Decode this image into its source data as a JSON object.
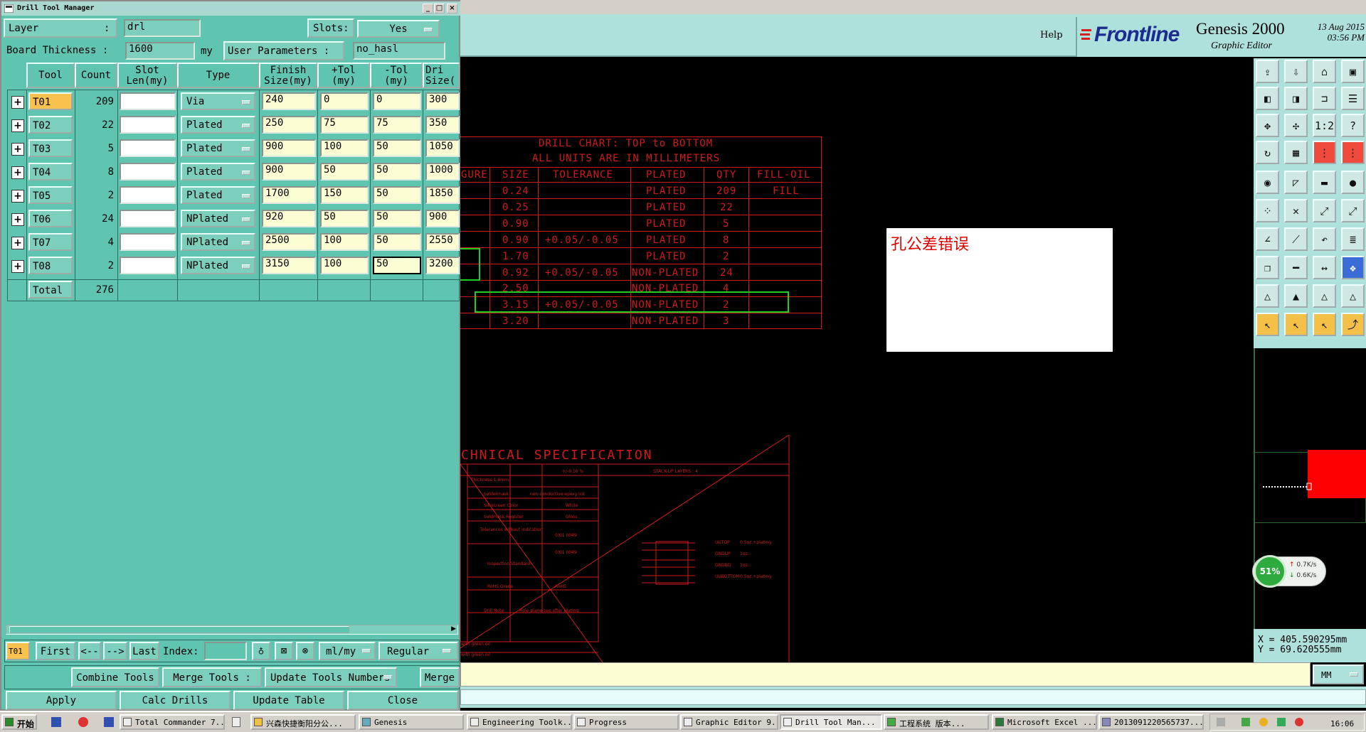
{
  "dialog": {
    "title": "Drill Tool Manager",
    "layer_label": "Layer",
    "layer_value": "drl",
    "slots_label": "Slots:",
    "slots_value": "Yes",
    "board_thickness_label": "Board Thickness :",
    "board_thickness_value": "1600",
    "board_thickness_unit": "my",
    "user_params_label": "User Parameters :",
    "user_params_value": "no_hasl",
    "columns": [
      "Tool",
      "Count",
      "Slot Len(my)",
      "Type",
      "Finish Size(my)",
      "+Tol (my)",
      "-Tol (my)",
      "Dri Size("
    ],
    "rows": [
      {
        "tool": "T01",
        "count": "209",
        "slot": "",
        "type": "Via",
        "finish": "240",
        "ptol": "0",
        "mtol": "0",
        "drill": "300"
      },
      {
        "tool": "T02",
        "count": "22",
        "slot": "",
        "type": "Plated",
        "finish": "250",
        "ptol": "75",
        "mtol": "75",
        "drill": "350"
      },
      {
        "tool": "T03",
        "count": "5",
        "slot": "",
        "type": "Plated",
        "finish": "900",
        "ptol": "100",
        "mtol": "50",
        "drill": "1050"
      },
      {
        "tool": "T04",
        "count": "8",
        "slot": "",
        "type": "Plated",
        "finish": "900",
        "ptol": "50",
        "mtol": "50",
        "drill": "1000"
      },
      {
        "tool": "T05",
        "count": "2",
        "slot": "",
        "type": "Plated",
        "finish": "1700",
        "ptol": "150",
        "mtol": "50",
        "drill": "1850"
      },
      {
        "tool": "T06",
        "count": "24",
        "slot": "",
        "type": "NPlated",
        "finish": "920",
        "ptol": "50",
        "mtol": "50",
        "drill": "900"
      },
      {
        "tool": "T07",
        "count": "4",
        "slot": "",
        "type": "NPlated",
        "finish": "2500",
        "ptol": "100",
        "mtol": "50",
        "drill": "2550"
      },
      {
        "tool": "T08",
        "count": "2",
        "slot": "",
        "type": "NPlated",
        "finish": "3150",
        "ptol": "100",
        "mtol": "50",
        "drill": "3200"
      }
    ],
    "total_label": "Total",
    "total_value": "276",
    "current_tool": "T01",
    "nav": {
      "first": "First",
      "prev": "<--",
      "next": "-->",
      "last": "Last",
      "index_label": "Index:",
      "index_value": "",
      "unit": "ml/my",
      "mode": "Regular"
    },
    "merge_row": {
      "combine": "Combine Tools",
      "merge_tools": "Merge Tools :",
      "update_numbers": "Update Tools Numbers",
      "merge": "Merge"
    },
    "bottom": {
      "apply": "Apply",
      "calc": "Calc Drills",
      "update": "Update Table",
      "close": "Close"
    }
  },
  "genesis": {
    "help": "Help",
    "logo": "Frontline",
    "title": "Genesis 2000",
    "subtitle": "Graphic Editor",
    "date": "13 Aug 2015",
    "time": "03:56 PM",
    "coord_x": "X = 405.590295mm",
    "coord_y": "Y =  69.620555mm",
    "unit": "MM",
    "net_percent": "51%",
    "net_up": "0.7K/s",
    "net_down": "0.6K/s"
  },
  "drill_chart": {
    "title1": "DRILL CHART: TOP to BOTTOM",
    "title2": "ALL UNITS ARE IN MILLIMETERS",
    "headers": [
      "GURE",
      "SIZE",
      "TOLERANCE",
      "PLATED",
      "QTY",
      "FILL-OIL"
    ],
    "rows": [
      {
        "size": "0.24",
        "tol": "",
        "plated": "PLATED",
        "qty": "209",
        "fill": "FILL"
      },
      {
        "size": "0.25",
        "tol": "",
        "plated": "PLATED",
        "qty": "22",
        "fill": ""
      },
      {
        "size": "0.90",
        "tol": "",
        "plated": "PLATED",
        "qty": "5",
        "fill": ""
      },
      {
        "size": "0.90",
        "tol": "+0.05/-0.05",
        "plated": "PLATED",
        "qty": "8",
        "fill": ""
      },
      {
        "size": "1.70",
        "tol": "",
        "plated": "PLATED",
        "qty": "2",
        "fill": ""
      },
      {
        "size": "0.92",
        "tol": "+0.05/-0.05",
        "plated": "NON-PLATED",
        "qty": "24",
        "fill": ""
      },
      {
        "size": "2.50",
        "tol": "",
        "plated": "NON-PLATED",
        "qty": "4",
        "fill": ""
      },
      {
        "size": "3.15",
        "tol": "+0.05/-0.05",
        "plated": "NON-PLATED",
        "qty": "2",
        "fill": ""
      },
      {
        "size": "3.20",
        "tol": "",
        "plated": "NON-PLATED",
        "qty": "3",
        "fill": ""
      }
    ],
    "spec_title": "CHNICAL SPECIFICATION",
    "spec_stackup": "STACK-UP LAYERS : 4",
    "spec_rows": [
      "Thickness:1.6mm",
      "Soldermask",
      "Silkscreen Color",
      "Soldmask Register",
      "Tolerances without indication",
      "Inspection Standard",
      "RoHS Grade",
      "Drill Note"
    ],
    "spec_vals": [
      "+/-0.10 %",
      "non-conductive epoxy ink",
      "White",
      "Gloss",
      "0/01 0049",
      "0/01 0049",
      "RoHS",
      "Hole plane see after plating"
    ],
    "stack_labels": [
      "0.5oz.+plating",
      "1oz.",
      "1oz.",
      "0.5oz.+plating"
    ],
    "stack_names": [
      "UUTOP",
      "GNDUP",
      "GNDBD",
      "UUBOTTOM"
    ],
    "spec_misc": [
      "with green oil",
      "with green oil"
    ]
  },
  "note": "孔公差错误",
  "taskbar": {
    "start": "开始",
    "items": [
      "Total Commander 7....",
      "兴森快捷衡阳分公...",
      "Genesis",
      "Engineering Toolk...",
      "Progress",
      "Graphic Editor 9....",
      "Drill Tool Man...",
      "工程系统   版本...",
      "Microsoft Excel ...",
      "2013091220565737..."
    ],
    "clock": "16:06"
  },
  "colors": {
    "dialog_bg": "#5fc4b0",
    "field_yellow": "#fdfdd4",
    "chart_red": "#d01a1a",
    "highlight_green": "#22cc22",
    "selected_tool": "#f9c24e"
  }
}
